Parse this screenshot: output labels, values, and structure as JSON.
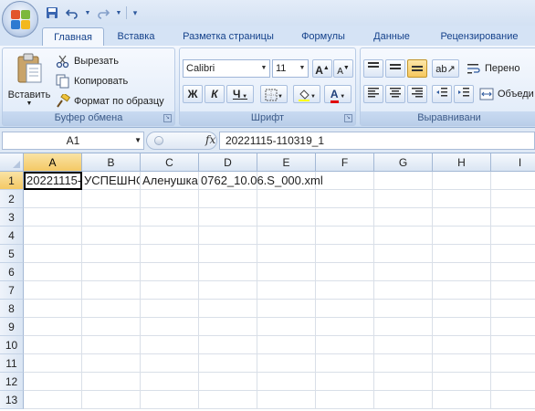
{
  "ribbon_tabs": [
    "Главная",
    "Вставка",
    "Разметка страницы",
    "Формулы",
    "Данные",
    "Рецензирование"
  ],
  "clipboard": {
    "paste": "Вставить",
    "cut": "Вырезать",
    "copy": "Копировать",
    "format_painter": "Формат по образцу",
    "label": "Буфер обмена"
  },
  "font": {
    "name": "Calibri",
    "size": "11",
    "bold": "Ж",
    "italic": "К",
    "underline": "Ч",
    "label": "Шрифт",
    "grow": "A",
    "shrink": "A",
    "color_letter": "A"
  },
  "alignment": {
    "wrap": "Перено",
    "merge": "Объеди",
    "label": "Выравнивани"
  },
  "formula_bar": {
    "name_box": "A1",
    "fx": "fx",
    "formula": "20221115-110319_1"
  },
  "columns": [
    "A",
    "B",
    "C",
    "D",
    "E",
    "F",
    "G",
    "H",
    "I"
  ],
  "rows": [
    "1",
    "2",
    "3",
    "4",
    "5",
    "6",
    "7",
    "8",
    "9",
    "10",
    "11",
    "12",
    "13"
  ],
  "cells": {
    "A1": "20221115-110319_1",
    "B1": "УСПЕШНО",
    "C1": "Аленушка",
    "D1": "0762_10.06.S_000.xml"
  },
  "colors": {
    "accent": "#15428b",
    "selected_header": "#f4c965",
    "font_color_bar": "#e00000",
    "highlight_bar": "#ffff00"
  }
}
